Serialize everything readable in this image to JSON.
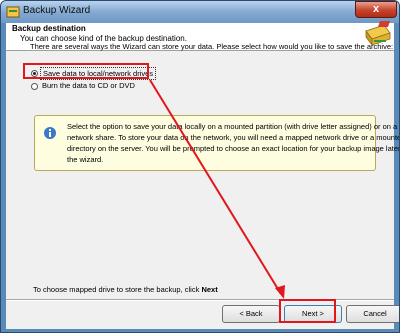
{
  "window": {
    "title": "Backup Wizard",
    "close_symbol": "x"
  },
  "header": {
    "title": "Backup destination",
    "subtitle": "You can choose kind of the backup destination."
  },
  "intro": "There are several ways the Wizard can store your data. Please select how would you like to save the archive:",
  "options": [
    {
      "label": "Save data to local/network drives",
      "selected": true
    },
    {
      "label": "Burn the data to CD or DVD",
      "selected": false
    }
  ],
  "info": {
    "lines": [
      "Select the option to save your data locally on a mounted partition (with drive letter assigned) or on a",
      "network share. To store your data on the network, you will need a mapped network drive or a mounted",
      "directory on the server. You will be prompted to choose an exact location for your backup image later in",
      "the wizard."
    ]
  },
  "hint": {
    "prefix": "To choose mapped drive to store the backup, click ",
    "bold": "Next"
  },
  "buttons": {
    "back": "< Back",
    "next": "Next >",
    "cancel": "Cancel"
  },
  "colors": {
    "annotation_red": "#e0181e",
    "titlebar": "#84a9d2",
    "info_bg": "#fffde0"
  }
}
